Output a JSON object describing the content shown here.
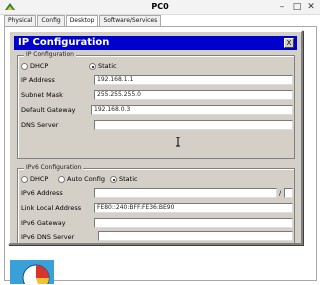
{
  "window": {
    "title": "PC0"
  },
  "tabs": [
    "Physical",
    "Config",
    "Desktop",
    "Software/Services"
  ],
  "ipconfig": {
    "title": "IP Configuration",
    "close_label": "X",
    "ipv4": {
      "group_title": "IP Configuration",
      "dhcp_label": "DHCP",
      "static_label": "Static",
      "selected": "static",
      "fields": [
        {
          "label": "IP Address",
          "value": "192.168.1.1"
        },
        {
          "label": "Subnet Mask",
          "value": "255.255.255.0"
        },
        {
          "label": "Default Gateway",
          "value": "192.168.0.3"
        },
        {
          "label": "DNS Server",
          "value": ""
        }
      ]
    },
    "ipv6": {
      "group_title": "IPv6 Configuration",
      "dhcp_label": "DHCP",
      "auto_label": "Auto Config",
      "static_label": "Static",
      "selected": "static",
      "address_label": "IPv6 Address",
      "address_value": "",
      "prefix_separator": "/",
      "prefix_value": "",
      "link_local_label": "Link Local Address",
      "link_local_value": "FE80::240:BFF:FE36:BE90",
      "gateway_label": "IPv6 Gateway",
      "gateway_value": "",
      "dns_label": "IPv6 DNS Server",
      "dns_value": ""
    }
  },
  "icons": {
    "app": "packet-tracer-icon",
    "pie": "pie-chart-icon"
  }
}
